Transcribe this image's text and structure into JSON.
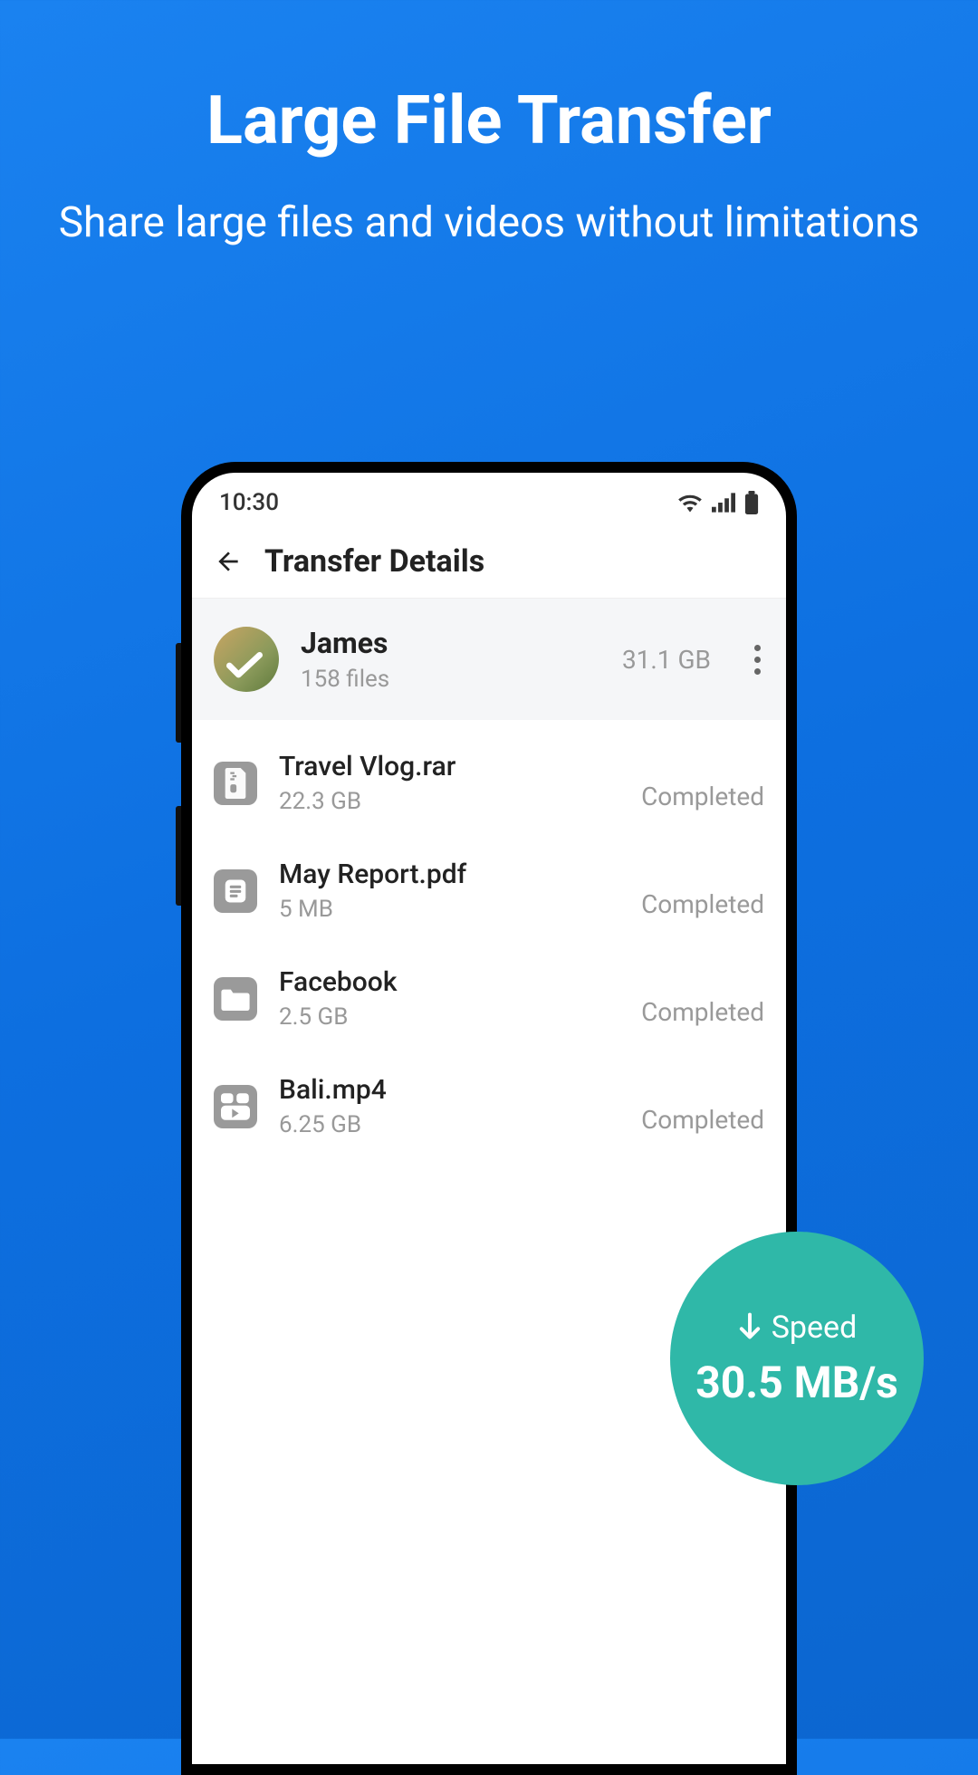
{
  "promo": {
    "title": "Large File Transfer",
    "subtitle": "Share large files and videos without limitations"
  },
  "status": {
    "time": "10:30"
  },
  "appbar": {
    "title": "Transfer Details"
  },
  "user": {
    "name": "James",
    "file_count": "158 files",
    "total_size": "31.1 GB"
  },
  "files": [
    {
      "name": "Travel Vlog.rar",
      "size": "22.3 GB",
      "status": "Completed",
      "type": "archive"
    },
    {
      "name": "May Report.pdf",
      "size": "5 MB",
      "status": "Completed",
      "type": "document"
    },
    {
      "name": "Facebook",
      "size": "2.5 GB",
      "status": "Completed",
      "type": "folder"
    },
    {
      "name": "Bali.mp4",
      "size": "6.25 GB",
      "status": "Completed",
      "type": "video"
    }
  ],
  "speed": {
    "label": "Speed",
    "value": "30.5 MB/s"
  }
}
